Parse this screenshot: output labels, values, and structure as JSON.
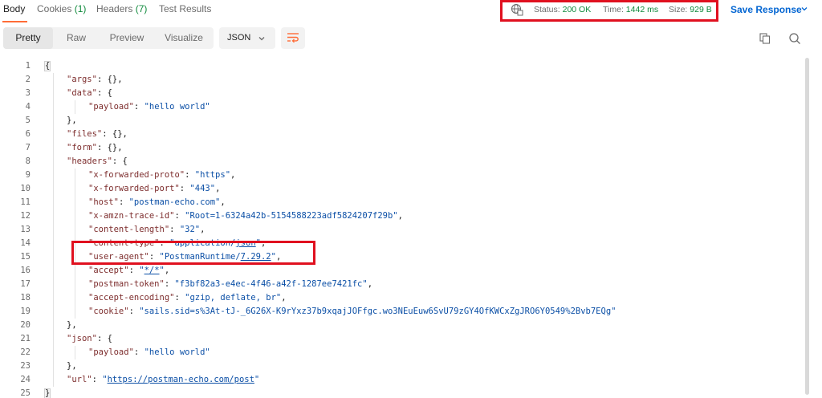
{
  "tabs": {
    "body": "Body",
    "cookies": "Cookies",
    "cookies_count": "(1)",
    "headers": "Headers",
    "headers_count": "(7)",
    "test_results": "Test Results"
  },
  "status": {
    "status_label": "Status:",
    "status_value": "200 OK",
    "time_label": "Time:",
    "time_value": "1442 ms",
    "size_label": "Size:",
    "size_value": "929 B",
    "globe_icon": "globe-icon"
  },
  "save_response": "Save Response",
  "views": [
    "Pretty",
    "Raw",
    "Preview",
    "Visualize"
  ],
  "format": "JSON",
  "colors": {
    "accent": "#ff6c37",
    "highlight": "#e0101f",
    "link": "#0265d2",
    "ok": "#0f8a3c",
    "string": "#0b4fa6",
    "key": "#7d2d2d"
  },
  "code": {
    "line_numbers": [
      "1",
      "2",
      "3",
      "4",
      "5",
      "6",
      "7",
      "8",
      "9",
      "10",
      "11",
      "12",
      "13",
      "14",
      "15",
      "16",
      "17",
      "18",
      "19",
      "20",
      "21",
      "22",
      "23",
      "24",
      "25"
    ],
    "lines": [
      [
        [
          "p",
          "{"
        ]
      ],
      [
        [
          "k",
          "\"args\""
        ],
        [
          "p",
          ": {},"
        ]
      ],
      [
        [
          "k",
          "\"data\""
        ],
        [
          "p",
          ": {"
        ]
      ],
      [
        [
          "k",
          "\"payload\""
        ],
        [
          "p",
          ": "
        ],
        [
          "s",
          "\"hello world\""
        ]
      ],
      [
        [
          "p",
          "},"
        ]
      ],
      [
        [
          "k",
          "\"files\""
        ],
        [
          "p",
          ": {},"
        ]
      ],
      [
        [
          "k",
          "\"form\""
        ],
        [
          "p",
          ": {},"
        ]
      ],
      [
        [
          "k",
          "\"headers\""
        ],
        [
          "p",
          ": {"
        ]
      ],
      [
        [
          "k",
          "\"x-forwarded-proto\""
        ],
        [
          "p",
          ": "
        ],
        [
          "s",
          "\"https\""
        ],
        [
          "p",
          ","
        ]
      ],
      [
        [
          "k",
          "\"x-forwarded-port\""
        ],
        [
          "p",
          ": "
        ],
        [
          "s",
          "\"443\""
        ],
        [
          "p",
          ","
        ]
      ],
      [
        [
          "k",
          "\"host\""
        ],
        [
          "p",
          ": "
        ],
        [
          "s",
          "\"postman-echo.com\""
        ],
        [
          "p",
          ","
        ]
      ],
      [
        [
          "k",
          "\"x-amzn-trace-id\""
        ],
        [
          "p",
          ": "
        ],
        [
          "s",
          "\"Root=1-6324a42b-5154588223adf5824207f29b\""
        ],
        [
          "p",
          ","
        ]
      ],
      [
        [
          "k",
          "\"content-length\""
        ],
        [
          "p",
          ": "
        ],
        [
          "s",
          "\"32\""
        ],
        [
          "p",
          ","
        ]
      ],
      [
        [
          "k",
          "\"content-type\""
        ],
        [
          "p",
          ": "
        ],
        [
          "s",
          "\"application/"
        ],
        [
          "su",
          "json"
        ],
        [
          "s",
          "\""
        ],
        [
          "p",
          ","
        ]
      ],
      [
        [
          "k",
          "\"user-agent\""
        ],
        [
          "p",
          ": "
        ],
        [
          "s",
          "\"PostmanRuntime/"
        ],
        [
          "su",
          "7.29.2"
        ],
        [
          "s",
          "\""
        ],
        [
          "p",
          ","
        ]
      ],
      [
        [
          "k",
          "\"accept\""
        ],
        [
          "p",
          ": "
        ],
        [
          "s",
          "\""
        ],
        [
          "su",
          "*/*"
        ],
        [
          "s",
          "\""
        ],
        [
          "p",
          ","
        ]
      ],
      [
        [
          "k",
          "\"postman-token\""
        ],
        [
          "p",
          ": "
        ],
        [
          "s",
          "\"f3bf82a3-e4ec-4f46-a42f-1287ee7421fc\""
        ],
        [
          "p",
          ","
        ]
      ],
      [
        [
          "k",
          "\"accept-encoding\""
        ],
        [
          "p",
          ": "
        ],
        [
          "s",
          "\"gzip, deflate, br\""
        ],
        [
          "p",
          ","
        ]
      ],
      [
        [
          "k",
          "\"cookie\""
        ],
        [
          "p",
          ": "
        ],
        [
          "s",
          "\"sails.sid=s%3At-tJ-_6G26X-K9rYxz37b9xqajJOFfgc.wo3NEuEuw6SvU79zGY4OfKWCxZgJRO6Y0549%2Bvb7EQg\""
        ]
      ],
      [
        [
          "p",
          "},"
        ]
      ],
      [
        [
          "k",
          "\"json\""
        ],
        [
          "p",
          ": {"
        ]
      ],
      [
        [
          "k",
          "\"payload\""
        ],
        [
          "p",
          ": "
        ],
        [
          "s",
          "\"hello world\""
        ]
      ],
      [
        [
          "p",
          "},"
        ]
      ],
      [
        [
          "k",
          "\"url\""
        ],
        [
          "p",
          ": "
        ],
        [
          "s",
          "\""
        ],
        [
          "su",
          "https://postman-echo.com/post"
        ],
        [
          "s",
          "\""
        ]
      ],
      [
        [
          "p",
          "}"
        ]
      ]
    ],
    "indent": [
      0,
      1,
      1,
      2,
      1,
      1,
      1,
      1,
      2,
      2,
      2,
      2,
      2,
      2,
      2,
      2,
      2,
      2,
      2,
      1,
      1,
      2,
      1,
      1,
      0
    ]
  }
}
